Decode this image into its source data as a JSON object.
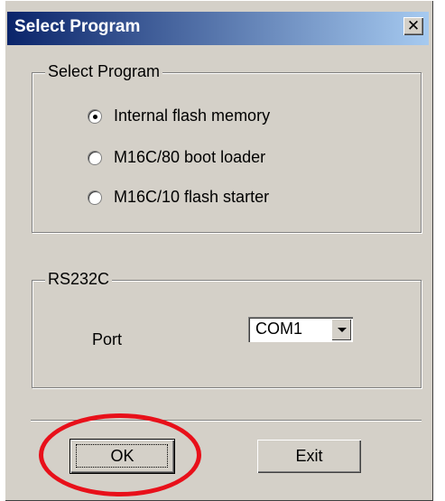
{
  "window": {
    "title": "Select Program",
    "close_glyph": "✕",
    "titlebar_color_start": "#0a246a",
    "titlebar_color_end": "#a6caf0",
    "background_color": "#d4d0c8"
  },
  "program_group": {
    "legend": "Select Program",
    "options": [
      {
        "label": "Internal flash memory",
        "checked": true
      },
      {
        "label": "M16C/80 boot loader",
        "checked": false
      },
      {
        "label": "M16C/10 flash starter",
        "checked": false
      }
    ]
  },
  "rs232c_group": {
    "legend": "RS232C",
    "port_label": "Port",
    "port_value": "COM1"
  },
  "buttons": {
    "ok_label": "OK",
    "exit_label": "Exit"
  },
  "annotation": {
    "highlight_color": "#e8101a",
    "highlight_icon": "red-ellipse"
  }
}
